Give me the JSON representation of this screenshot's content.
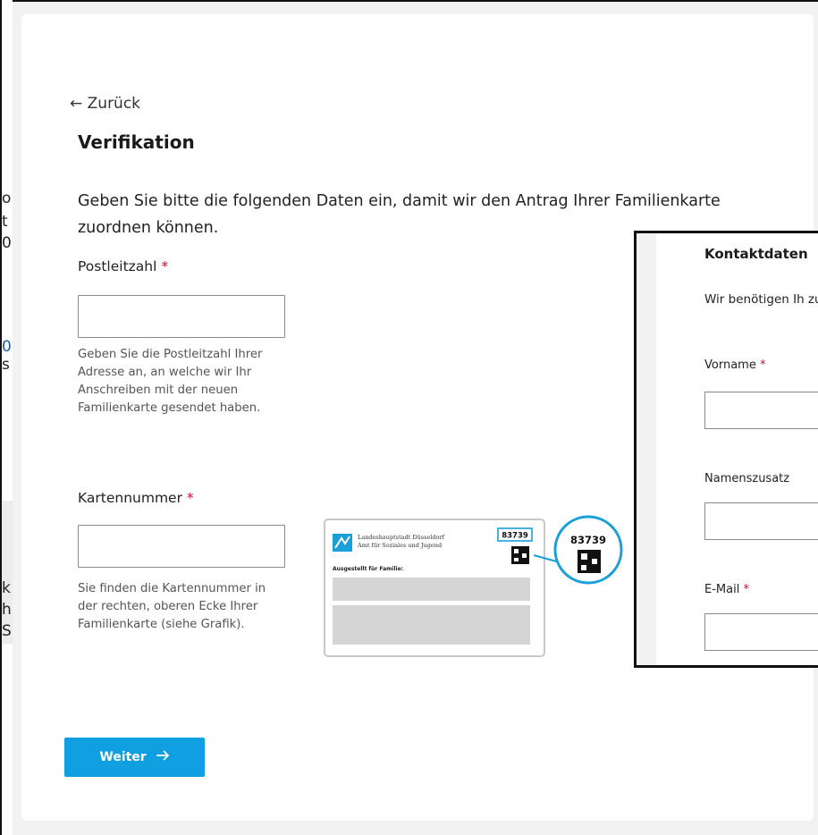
{
  "background_fragments": [
    "o",
    "t",
    "0",
    "0",
    "s",
    "k",
    "h",
    "S"
  ],
  "form": {
    "back_label": "← Zurück",
    "title": "Verifikation",
    "intro": "Geben Sie bitte die folgenden Daten ein, damit wir den Antrag Ihrer Familienkarte zuordnen können.",
    "postal_code": {
      "label": "Postleitzahl",
      "required_mark": "*",
      "value": "",
      "help": "Geben Sie die Postleitzahl Ihrer Adresse an, an welche wir Ihr Anschreiben mit der neuen Familienkarte gesendet haben."
    },
    "card_number": {
      "label": "Kartennummer",
      "required_mark": "*",
      "value": "",
      "help": "Sie finden die Kartennummer in der rechten, oberen Ecke Ihrer Familienkarte (siehe Grafik)."
    },
    "submit_label": "Weiter",
    "submit_icon": "arrow-right-icon"
  },
  "card_graphic": {
    "issuer_line1": "Landeshauptstadt Düsseldorf",
    "issuer_line2": "Amt für Soziales und Jugend",
    "issued_for_label": "Ausgestellt für Familie:",
    "card_number": "83739",
    "zoom_number": "83739"
  },
  "overlay": {
    "title": "Kontaktdaten",
    "text": "Wir benötigen Ih zuschicken könn",
    "fields": [
      {
        "label": "Vorname",
        "required_mark": "*"
      },
      {
        "label": "Namenszusatz",
        "required_mark": ""
      },
      {
        "label": "E-Mail",
        "required_mark": "*"
      }
    ]
  },
  "colors": {
    "accent": "#109fe0",
    "required": "#c8102e",
    "zoom_circle": "#1aa0d8"
  }
}
